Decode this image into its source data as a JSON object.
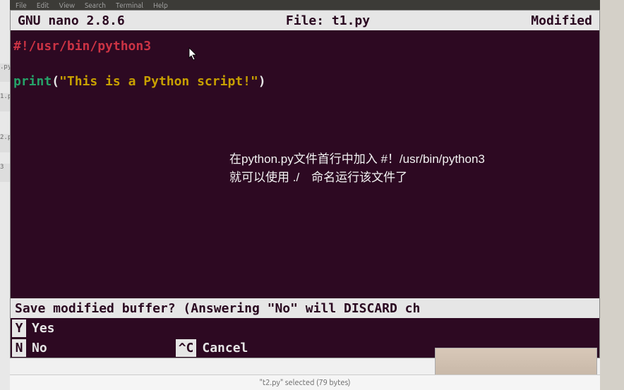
{
  "menubar": [
    "File",
    "Edit",
    "View",
    "Search",
    "Terminal",
    "Help"
  ],
  "left_tabs": [
    ".py",
    "1.p",
    "2.p",
    "3"
  ],
  "nano": {
    "app": "GNU nano 2.8.6",
    "file_label": "File: t1.py",
    "status": "Modified"
  },
  "code": {
    "line1": "#!/usr/bin/python3",
    "line3_func": "print",
    "line3_open": "(",
    "line3_str": "\"This is a Python script!\"",
    "line3_close": ")"
  },
  "annotation": {
    "line1": "在python.py文件首行中加入 #！/usr/bin/python3",
    "line2": "就可以使用 ./ 命名运行该文件了"
  },
  "prompt": {
    "question": "Save modified buffer?  (Answering \"No\" will DISCARD ch",
    "yes_key": "Y",
    "yes_label": "Yes",
    "no_key": "N",
    "no_label": "No",
    "cancel_key": "^C",
    "cancel_label": "Cancel"
  },
  "statusbar": "\"t2.py\" selected (79 bytes)"
}
